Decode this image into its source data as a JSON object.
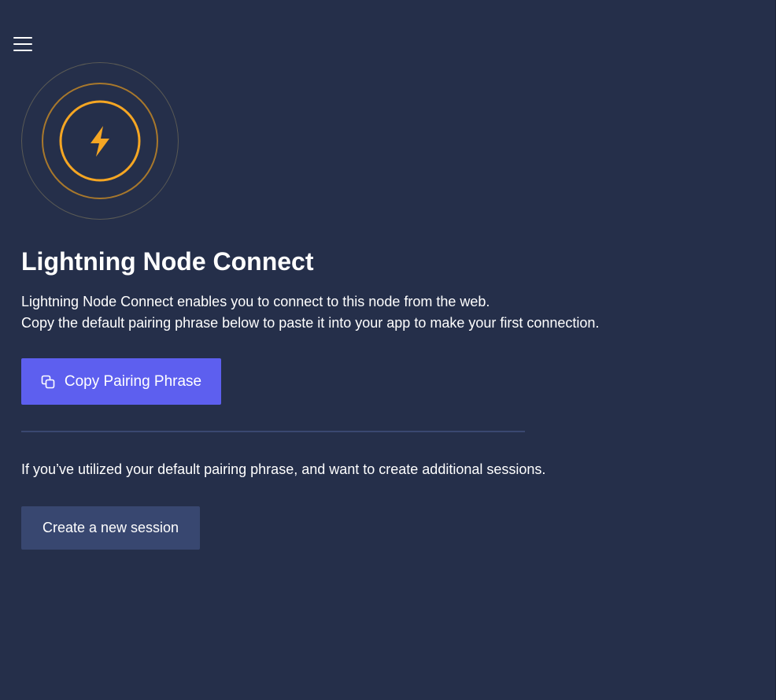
{
  "header": {
    "menu_icon": "hamburger-menu-icon"
  },
  "logo": {
    "icon": "lightning-bolt-icon",
    "accent_color": "#f5a623"
  },
  "main": {
    "title": "Lightning Node Connect",
    "description_line1": "Lightning Node Connect enables you to connect to this node from the web.",
    "description_line2": "Copy the default pairing phrase below to paste it into your app to make your first connection.",
    "copy_button_label": "Copy Pairing Phrase",
    "copy_button_icon": "copy-icon",
    "note": "If you’ve utilized your default pairing phrase, and want to create additional sessions.",
    "create_session_label": "Create a new session"
  },
  "colors": {
    "background": "#252f4a",
    "primary_button": "#5d5fef",
    "secondary_button": "#384770",
    "divider": "#3a4870"
  }
}
